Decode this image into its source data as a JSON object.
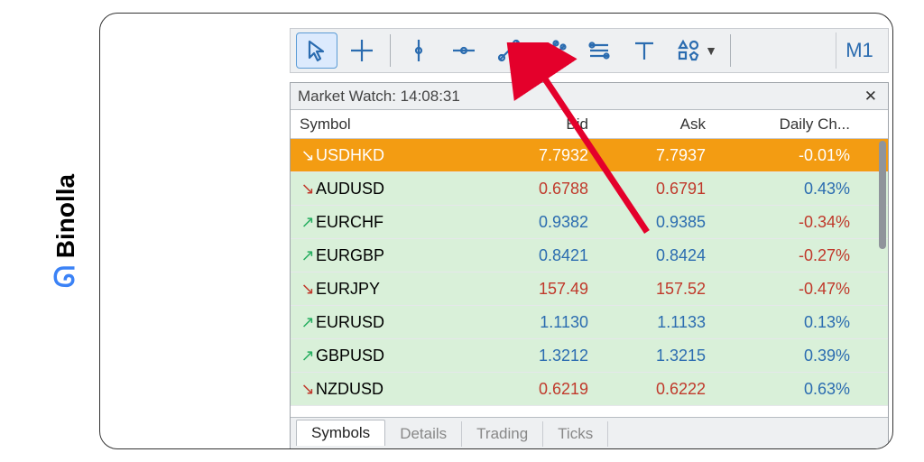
{
  "brand": {
    "name": "Binolla"
  },
  "toolbar": {
    "tools": [
      "cursor",
      "crosshair",
      "vline",
      "hline",
      "trendline",
      "channel",
      "fibo",
      "text",
      "shapes"
    ],
    "timeframe": "M1"
  },
  "panel": {
    "title": "Market Watch: 14:08:31",
    "columns": {
      "symbol": "Symbol",
      "bid": "Bid",
      "ask": "Ask",
      "change": "Daily Ch..."
    },
    "rows": [
      {
        "dir": "down",
        "symbol": "USDHKD",
        "bid": "7.7932",
        "ask": "7.7937",
        "chg": "-0.01%",
        "bidColor": "red",
        "askColor": "red",
        "chgColor": "red",
        "hl": true
      },
      {
        "dir": "down",
        "symbol": "AUDUSD",
        "bid": "0.6788",
        "ask": "0.6791",
        "chg": "0.43%",
        "bidColor": "red",
        "askColor": "red",
        "chgColor": "blue"
      },
      {
        "dir": "up",
        "symbol": "EURCHF",
        "bid": "0.9382",
        "ask": "0.9385",
        "chg": "-0.34%",
        "bidColor": "blue",
        "askColor": "blue",
        "chgColor": "red"
      },
      {
        "dir": "up",
        "symbol": "EURGBP",
        "bid": "0.8421",
        "ask": "0.8424",
        "chg": "-0.27%",
        "bidColor": "blue",
        "askColor": "blue",
        "chgColor": "red"
      },
      {
        "dir": "down",
        "symbol": "EURJPY",
        "bid": "157.49",
        "ask": "157.52",
        "chg": "-0.47%",
        "bidColor": "red",
        "askColor": "red",
        "chgColor": "red"
      },
      {
        "dir": "up",
        "symbol": "EURUSD",
        "bid": "1.1130",
        "ask": "1.1133",
        "chg": "0.13%",
        "bidColor": "blue",
        "askColor": "blue",
        "chgColor": "blue"
      },
      {
        "dir": "up",
        "symbol": "GBPUSD",
        "bid": "1.3212",
        "ask": "1.3215",
        "chg": "0.39%",
        "bidColor": "blue",
        "askColor": "blue",
        "chgColor": "blue"
      },
      {
        "dir": "down",
        "symbol": "NZDUSD",
        "bid": "0.6219",
        "ask": "0.6222",
        "chg": "0.63%",
        "bidColor": "red",
        "askColor": "red",
        "chgColor": "blue"
      }
    ],
    "tabs": [
      "Symbols",
      "Details",
      "Trading",
      "Ticks"
    ],
    "activeTab": 0
  }
}
